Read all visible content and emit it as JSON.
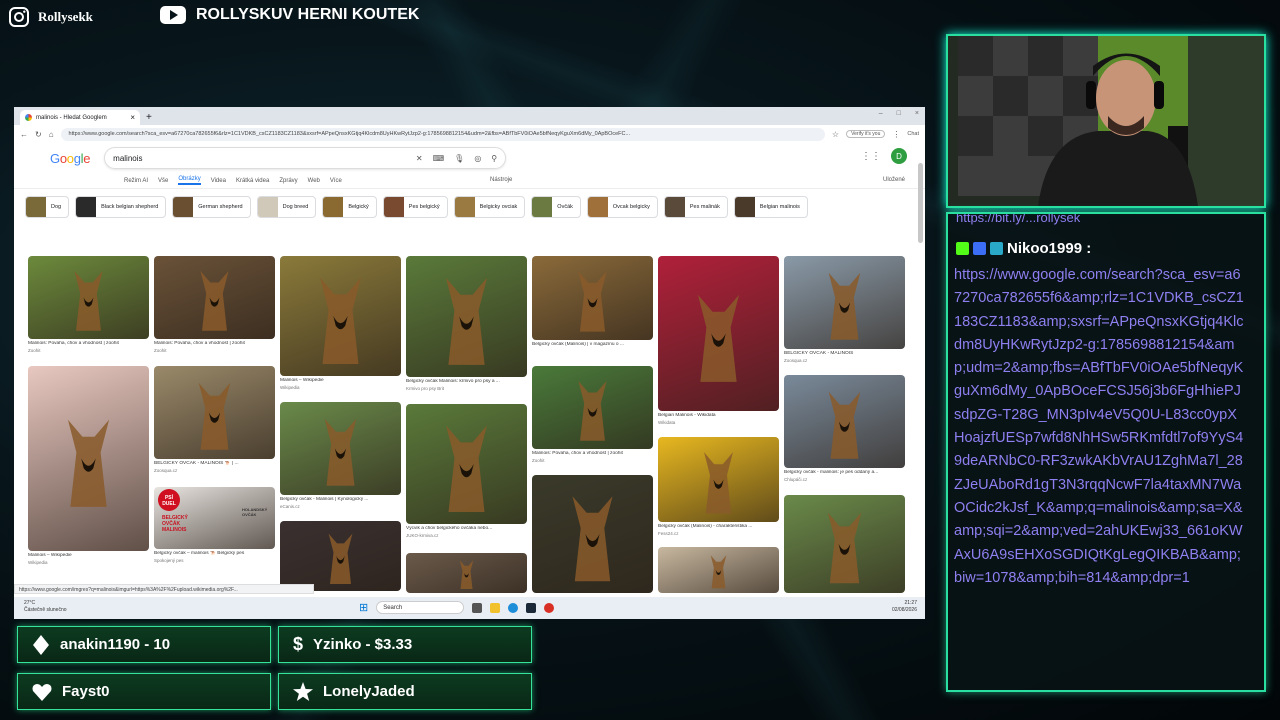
{
  "overlay": {
    "instagram": "Rollysekk",
    "youtube": "ROLLYSKUV HERNI KOUTEK"
  },
  "browser": {
    "tab_title": "malinois - Hledat Googlem",
    "url": "https://www.google.com/search?sca_esv=a67270ca782655f6&rlz=1C1VDKB_csCZ1183CZ1183&sxsrf=APpeQnsxKGtjq4Klcdm8UyHKwRytJzp2-g:1785698812154&udm=2&fbs=ABfTbFV0iOAe5bfNeqyKguXm6dMy_0ApBOceFC...",
    "verify_label": "Verify it's you",
    "chat_label": "Chat",
    "google_logo": "Google",
    "query": "malinois",
    "filters": [
      "Režim AI",
      "Vše",
      "Obrázky",
      "Videa",
      "Krátká videa",
      "Zprávy",
      "Web",
      "Více"
    ],
    "active_filter_index": 2,
    "tools_label": "Nástroje",
    "saved_label": "Uložené",
    "avatar_letter": "D",
    "chips": [
      {
        "label": "Dog",
        "color": "#7a6a3a"
      },
      {
        "label": "Black belgian shepherd",
        "color": "#2a2a2a"
      },
      {
        "label": "German shepherd",
        "color": "#6a5030"
      },
      {
        "label": "Dog breed",
        "color": "#d0c8b8"
      },
      {
        "label": "Belgický",
        "color": "#8a6a30"
      },
      {
        "label": "Pes belgický",
        "color": "#7a4a30"
      },
      {
        "label": "Belgicky ovciak",
        "color": "#9a7a40"
      },
      {
        "label": "Ovčák",
        "color": "#6a7a40"
      },
      {
        "label": "Ovcak belgicky",
        "color": "#a0703a"
      },
      {
        "label": "Pes malinák",
        "color": "#5a4a3a"
      },
      {
        "label": "Belgian malinois",
        "color": "#4a3a2a"
      }
    ],
    "results": [
      {
        "caption": "Malinois: Povaha, chov a vhodnost | zoohit",
        "source": "Zoohit",
        "color": "#6c8a3c"
      },
      {
        "caption": "Malinois: Povaha, chov a vhodnost | zoohit",
        "source": "Zoohit",
        "color": "#6a5238"
      },
      {
        "caption": "Malinois – Wikipedie",
        "source": "Wikipedia",
        "color": "#8a7a3a"
      },
      {
        "caption": "Belgický ovčák Malinois: krmivo pro psy a ...",
        "source": "Krmivo pro psy Brit",
        "color": "#5a7a3a"
      },
      {
        "caption": "Belgický ovčák (Malinois) | v magazínu o ...",
        "source": "",
        "color": "#8a6a3a"
      },
      {
        "caption": "Belgian Malinois - Wikidata",
        "source": "Wikidata",
        "color": "#b0203a"
      },
      {
        "caption": "BELGICKÝ OVČÁK - MALINOIS",
        "source": "Zoosqua.cz",
        "color": "#8a9aa8"
      },
      {
        "caption": "Malinois – Wikipedie",
        "source": "Wikipedia",
        "color": "#e8c8c0"
      },
      {
        "caption": "BELGICKÝ OVČÁK - MALINOIS 🐕 | ...",
        "source": "Zoosqua.cz",
        "color": "#9a8a6a"
      },
      {
        "caption": "Belgický ovčák - Malinois | Kynologický ...",
        "source": "eCanis.cz",
        "color": "#6a8a4a"
      },
      {
        "caption": "Výcvik a chov belgického ovčáka nebo...",
        "source": "JUKO-krmiva.cz",
        "color": "#5a7a3a"
      },
      {
        "caption": "Malinois: Povaha, chov a vhodnost | zoohit",
        "source": "Zoohit",
        "color": "#4a7a3a"
      },
      {
        "caption": "Belgický ovčák (Malinois) - charakteristika ...",
        "source": "Fess24.cz",
        "color": "#e8b820"
      },
      {
        "caption": "Belgický ovčák - malinois: je pes oddaný a...",
        "source": "Chlupáči.cz",
        "color": "#7a8a9a"
      },
      {
        "caption": "Belgický ovčák – malinois 🐕 Belgický pes",
        "source": "Spokojený pes",
        "color": "#e8e4e0"
      },
      {
        "caption": "",
        "source": "",
        "color": "#3a3030"
      },
      {
        "caption": "",
        "source": "",
        "color": "#6a5a4a"
      },
      {
        "caption": "",
        "source": "",
        "color": "#3a3a2a"
      },
      {
        "caption": "",
        "source": "",
        "color": "#c8b8a0"
      },
      {
        "caption": "",
        "source": "",
        "color": "#6a8a4a"
      }
    ],
    "duel_label": "PSÍ DUEL",
    "duel_text": "BELGICKÝ OVČÁK MALINOIS",
    "duel_text2": "HOLANDSKÝ OVČÁK",
    "status_url": "https://www.google.com/imgres?q=malinois&imgurl=https%3A%2F%2Fupload.wikimedia.org%2F...",
    "taskbar": {
      "weather_temp": "27°C",
      "weather_desc": "Částečně slunečno",
      "search_label": "Search",
      "time": "21:27",
      "date": "02/08/2026"
    }
  },
  "chat": {
    "prev_line": "https://bit.ly/...rollysek",
    "username": "Nikoo1999 :",
    "message": "https://www.google.com/search?sca_esv=a67270ca782655f6&amp;rlz=1C1VDKB_csCZ1183CZ1183&amp;sxsrf=APpeQnsxKGtjq4Klcdm8UyHKwRytJzp2-g:1785698812154&amp;udm=2&amp;fbs=ABfTbFV0iOAe5bfNeqyKguXm6dMy_0ApBOceFCSJ56j3b6FgHhiePJsdpZG-T28G_MN3pIv4eV5Q0U-L83cc0ypXHoajzfUESp7wfd8NhHSw5RKmfdtl7of9YyS49deARNbC0-RF3zwkAKbVrAU1ZghMa7l_28ZJeUAboRd1gT3N3rqqNcwF7la4taxMN7WaOCidc2kJsf_K&amp;q=malinois&amp;sa=X&amp;sqi=2&amp;ved=2ahUKEwj33_661oKWAxU6A9sEHXoSGDIQtKgLegQIKBAB&amp;biw=1078&amp;bih=814&amp;dpr=1"
  },
  "alerts": [
    {
      "label": "anakin1190 - 10",
      "icon": "diamond-icon"
    },
    {
      "label": "Yzinko - $3.33",
      "icon": "dollar-icon"
    },
    {
      "label": "Fayst0",
      "icon": "heart-icon"
    },
    {
      "label": "LonelyJaded",
      "icon": "star-icon"
    }
  ]
}
